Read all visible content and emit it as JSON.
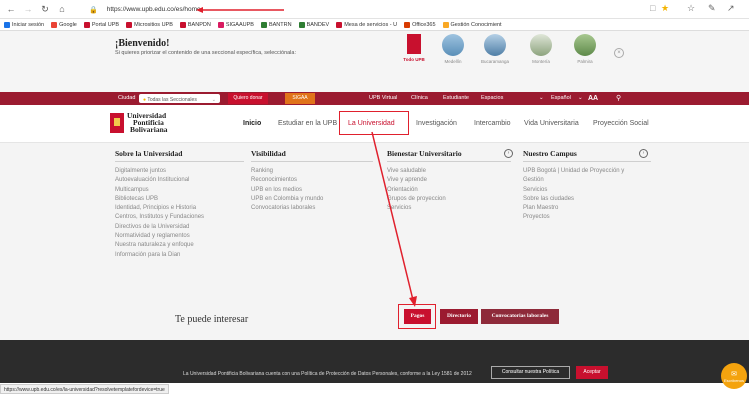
{
  "browser": {
    "url": "https://www.upb.edu.co/es/home",
    "bookmarks": [
      {
        "label": "Iniciar sesión",
        "color": "#1a73e8"
      },
      {
        "label": "Google",
        "color": "#ea4335"
      },
      {
        "label": "Portal UPB",
        "color": "#c8102e"
      },
      {
        "label": "Micrositios UPB",
        "color": "#c8102e"
      },
      {
        "label": "BANPDN",
        "color": "#c8102e"
      },
      {
        "label": "SIGAAUPB",
        "color": "#d81b60"
      },
      {
        "label": "BANTRN",
        "color": "#2e7d32"
      },
      {
        "label": "BANDEV",
        "color": "#2e7d32"
      },
      {
        "label": "Mesa de servicios - U",
        "color": "#c8102e"
      },
      {
        "label": "Office365",
        "color": "#d83b01"
      },
      {
        "label": "Gestión Conocimient",
        "color": "#f9a825"
      }
    ]
  },
  "welcome": {
    "title": "¡Bienvenido!",
    "subtitle": "Si quieres priorizar el contenido de una seccional específica, selecciónala:",
    "campuses": [
      "Todo UPB",
      "Medellín",
      "Bucaramanga",
      "Montería",
      "Palmira"
    ]
  },
  "topbar": {
    "city_label": "Ciudad",
    "city_value": "Todas las Seccionales",
    "donate": "Quiero donar",
    "sigaa": "SIGAA",
    "links": [
      "UPB Virtual",
      "Clínica",
      "Estudiante",
      "Espacios"
    ],
    "language": "Español",
    "font_size": "AA"
  },
  "nav": {
    "logo": [
      "Universidad",
      "Pontificia",
      "Bolivariana"
    ],
    "items": [
      "Inicio",
      "Estudiar en la UPB",
      "La Universidad",
      "Investigación",
      "Intercambio",
      "Vida Universitaria",
      "Proyección Social"
    ]
  },
  "menu": {
    "columns": [
      {
        "title": "Sobre la Universidad",
        "items": [
          "Digitalmente juntos",
          "Autoevaluación Institucional",
          "Multicampus",
          "Bibliotecas UPB",
          "Identidad, Principios e Historia",
          "Centros, Institutos y Fundaciones",
          "Directivos de la Universidad",
          "Normatividad y reglamentos",
          "Nuestra naturaleza y enfoque",
          "Información para la Dian"
        ]
      },
      {
        "title": "Visibilidad",
        "items": [
          "Ranking",
          "Reconocimientos",
          "UPB en los medios",
          "UPB en Colombia y mundo",
          "Convocatorias laborales"
        ]
      },
      {
        "title": "Bienestar Universitario",
        "items": [
          "Vive saludable",
          "Vive y aprende",
          "Orientación",
          "Grupos de proyeccion",
          "Servicios"
        ]
      },
      {
        "title": "Nuestro Campus",
        "items": [
          "UPB Bogotá | Unidad de Proyección y",
          "Gestión",
          "Servicios",
          "Sobre las ciudades",
          "Plan Maestro",
          "Proyectos"
        ]
      }
    ],
    "interest_title": "Te puede interesar",
    "interest_buttons": [
      {
        "label": "Pagos",
        "color": "#c8102e"
      },
      {
        "label": "Directorio",
        "color": "#9b1b30"
      },
      {
        "label": "Convocatorias laborales",
        "color": "#8e2a3a"
      }
    ]
  },
  "footer": {
    "cookie_text": "La Universidad Pontificia Bolivariana cuenta con una Política de Protección de Datos Personales, conforme a la Ley 1581 de 2012",
    "policy_button": "Consultar nuestra Política",
    "accept_button": "Aceptar",
    "chat_label": "Escríbenos"
  },
  "status_url": "https://www.upb.edu.co/es/la-universidad?resolvetemplatefordevice=true"
}
